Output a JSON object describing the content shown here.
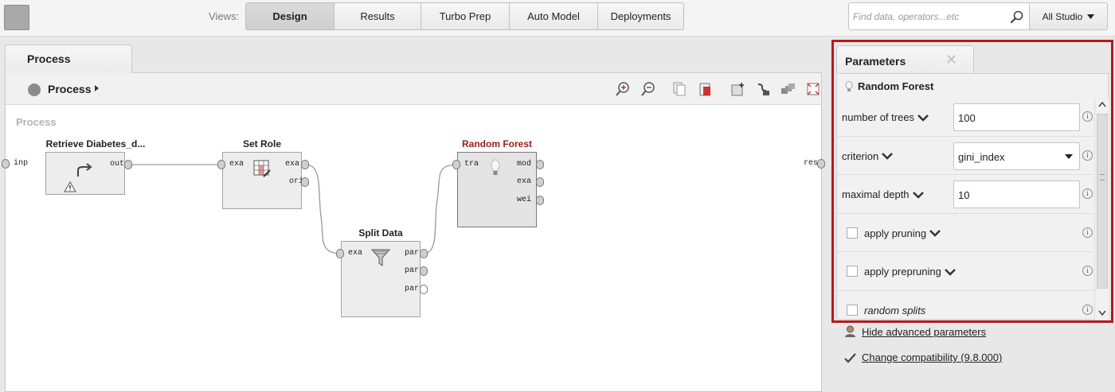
{
  "header": {
    "views_label": "Views:",
    "views": [
      {
        "label": "Design",
        "active": true
      },
      {
        "label": "Results",
        "active": false
      },
      {
        "label": "Turbo Prep",
        "active": false
      },
      {
        "label": "Auto Model",
        "active": false
      },
      {
        "label": "Deployments",
        "active": false
      }
    ],
    "search_placeholder": "Find data, operators...etc",
    "studio_label": "All Studio"
  },
  "process": {
    "tab_label": "Process",
    "breadcrumb": "Process",
    "canvas_title": "Process",
    "left_port": "inp",
    "right_port": "res",
    "operators": {
      "retrieve": {
        "title": "Retrieve Diabetes_d...",
        "ports_out": [
          "out"
        ]
      },
      "set_role": {
        "title": "Set Role",
        "ports_in": [
          "exa"
        ],
        "ports_out": [
          "exa",
          "ori"
        ]
      },
      "split_data": {
        "title": "Split Data",
        "ports_in": [
          "exa"
        ],
        "ports_out": [
          "par",
          "par",
          "par"
        ]
      },
      "random_forest": {
        "title": "Random Forest",
        "ports_in": [
          "tra"
        ],
        "ports_out": [
          "mod",
          "exa",
          "wei"
        ]
      }
    }
  },
  "parameters": {
    "tab_label": "Parameters",
    "operator_name": "Random Forest",
    "rows": [
      {
        "label": "number of trees",
        "value": "100"
      },
      {
        "label": "criterion",
        "value": "gini_index"
      },
      {
        "label": "maximal depth",
        "value": "10"
      },
      {
        "label": "apply pruning"
      },
      {
        "label": "apply prepruning"
      },
      {
        "label": "random splits"
      }
    ],
    "hide_advanced": "Hide advanced parameters",
    "compatibility": "Change compatibility (9.8.000)"
  },
  "colors": {
    "highlight_border": "#b01c1c",
    "selected_title": "#9b1b1b"
  }
}
